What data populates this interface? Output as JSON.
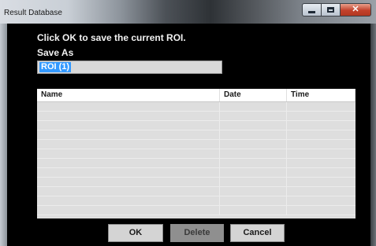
{
  "window": {
    "title": "Result Database",
    "minimize_icon": "minimize-icon",
    "maximize_icon": "maximize-icon",
    "close_icon": "close-icon"
  },
  "dialog": {
    "prompt": "Click OK to save the current ROI.",
    "save_as_label": "Save As",
    "save_as_value": "ROI (1)"
  },
  "table": {
    "columns": [
      "Name",
      "Date",
      "Time"
    ],
    "rows": [
      [
        "",
        "",
        ""
      ],
      [
        "",
        "",
        ""
      ],
      [
        "",
        "",
        ""
      ],
      [
        "",
        "",
        ""
      ],
      [
        "",
        "",
        ""
      ],
      [
        "",
        "",
        ""
      ],
      [
        "",
        "",
        ""
      ],
      [
        "",
        "",
        ""
      ],
      [
        "",
        "",
        ""
      ],
      [
        "",
        "",
        ""
      ],
      [
        "",
        "",
        ""
      ],
      [
        "",
        "",
        ""
      ]
    ]
  },
  "buttons": {
    "ok": "OK",
    "delete": "Delete",
    "cancel": "Cancel"
  },
  "colors": {
    "selection": "#3399ff",
    "close_button": "#c2412b",
    "client_background": "#000000"
  }
}
